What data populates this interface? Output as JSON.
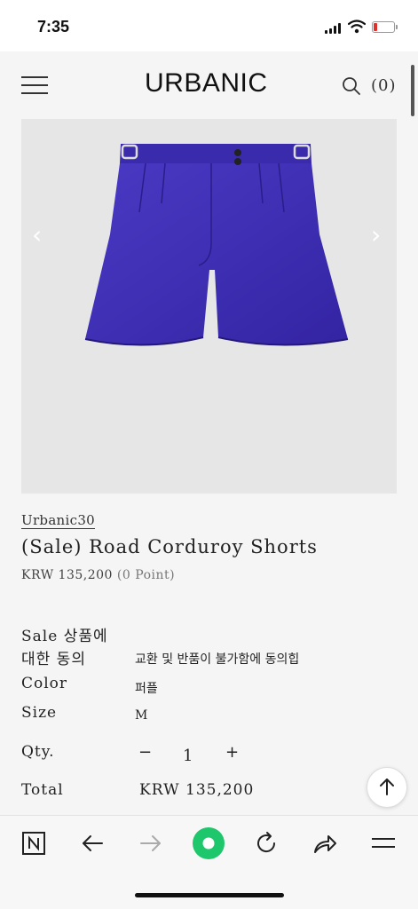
{
  "status_bar": {
    "time": "7:35"
  },
  "header": {
    "logo": "URBANIC",
    "cart_count": "(0)"
  },
  "product": {
    "brand": "Urbanic30",
    "title": "(Sale) Road Corduroy Shorts",
    "price": "KRW 135,200",
    "points": "(0 Point)",
    "image_color": "#3f2fb4"
  },
  "options": {
    "sale_agreement_label_1": "Sale 상품에",
    "sale_agreement_label_2": "대한 동의",
    "sale_agreement_value": "교환 및 반품이 불가함에 동의힙",
    "color_label": "Color",
    "color_value": "퍼플",
    "size_label": "Size",
    "size_value": "M",
    "qty_label": "Qty.",
    "qty_minus": "−",
    "qty_value": "1",
    "qty_plus": "+",
    "total_label": "Total",
    "total_value": "KRW 135,200"
  },
  "battery": {
    "level": 0.2,
    "color": "#e0302a"
  },
  "accent": {
    "browser_green": "#1ec76b"
  },
  "icons": [
    "menu-icon",
    "search-icon",
    "chevron-left-icon",
    "chevron-right-icon",
    "arrow-up-icon",
    "naver-n-icon",
    "back-icon",
    "forward-icon",
    "home-icon",
    "reload-icon",
    "share-icon",
    "menu-icon"
  ]
}
